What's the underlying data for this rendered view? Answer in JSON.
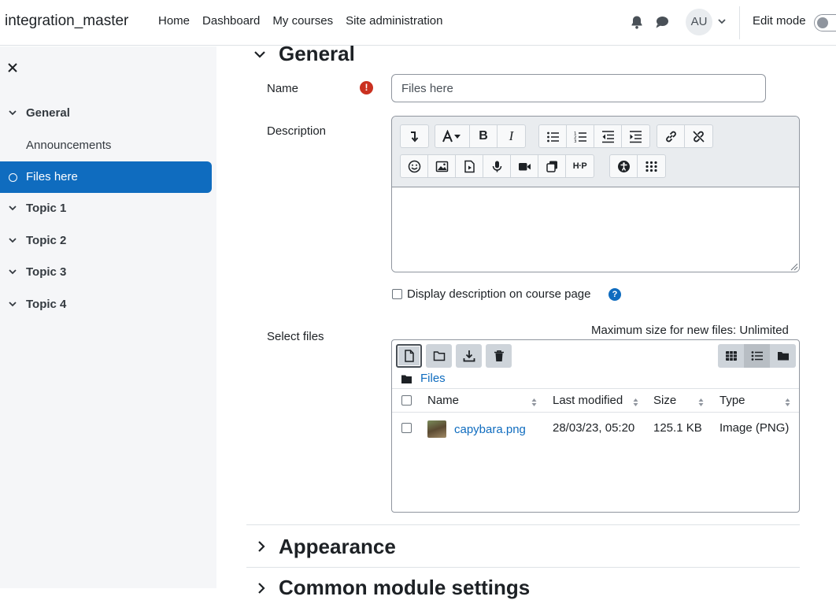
{
  "navbar": {
    "site_name": "integration_master",
    "links": [
      "Home",
      "Dashboard",
      "My courses",
      "Site administration"
    ],
    "avatar_initials": "AU",
    "edit_mode_label": "Edit mode",
    "edit_mode_on": false
  },
  "drawer": {
    "items": [
      {
        "label": "General",
        "type": "section"
      },
      {
        "label": "Announcements",
        "type": "activity"
      },
      {
        "label": "Files here",
        "type": "activity",
        "active": true
      },
      {
        "label": "Topic 1",
        "type": "section"
      },
      {
        "label": "Topic 2",
        "type": "section"
      },
      {
        "label": "Topic 3",
        "type": "section"
      },
      {
        "label": "Topic 4",
        "type": "section"
      }
    ]
  },
  "form": {
    "section_general": "General",
    "name_label": "Name",
    "name_value": "Files here",
    "description_label": "Description",
    "display_description_label": "Display description on course page",
    "select_files_label": "Select files",
    "max_size_text": "Maximum size for new files: Unlimited",
    "section_appearance": "Appearance",
    "section_common": "Common module settings"
  },
  "filepicker": {
    "path_root": "Files",
    "columns": [
      "Name",
      "Last modified",
      "Size",
      "Type"
    ],
    "files": [
      {
        "name": "capybara.png",
        "modified": "28/03/23, 05:20",
        "size": "125.1 KB",
        "type": "Image (PNG)"
      }
    ]
  },
  "colors": {
    "primary": "#0f6cbf",
    "required": "#ca3120",
    "drawer_bg": "#f5f6f8"
  },
  "editor_toolbar_icons": [
    "collapse-icon",
    "font-style-icon",
    "bold-icon",
    "italic-icon",
    "unordered-list-icon",
    "ordered-list-icon",
    "outdent-icon",
    "indent-icon",
    "link-icon",
    "unlink-icon",
    "emoji-icon",
    "image-icon",
    "media-icon",
    "record-audio-icon",
    "record-video-icon",
    "manage-files-icon",
    "h5p-icon",
    "accessibility-icon",
    "screenreader-helper-icon"
  ]
}
